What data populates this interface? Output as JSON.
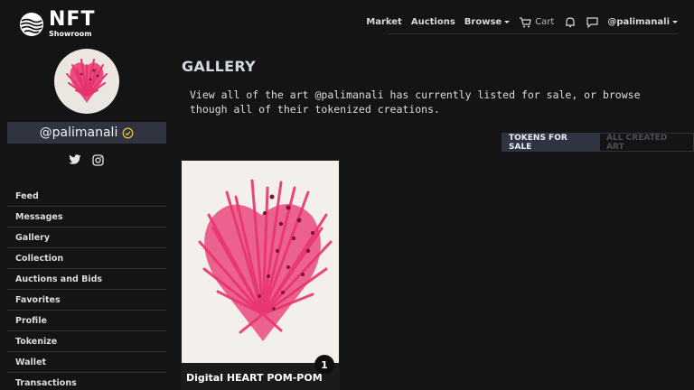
{
  "brand": {
    "name": "NFT",
    "subtitle": "Showroom"
  },
  "nav": {
    "market": "Market",
    "auctions": "Auctions",
    "browse": "Browse",
    "cart": "Cart",
    "user": "@palimanali"
  },
  "profile": {
    "username": "@palimanali",
    "verified": true
  },
  "sidebar": {
    "items": [
      {
        "label": "Feed"
      },
      {
        "label": "Messages"
      },
      {
        "label": "Gallery"
      },
      {
        "label": "Collection"
      },
      {
        "label": "Auctions and Bids"
      },
      {
        "label": "Favorites"
      },
      {
        "label": "Profile"
      },
      {
        "label": "Tokenize"
      },
      {
        "label": "Wallet"
      },
      {
        "label": "Transactions"
      }
    ]
  },
  "main": {
    "title": "GALLERY",
    "intro": "View all of the art @palimanali has currently listed for sale, or browse though all of their tokenized creations.",
    "tabs": [
      {
        "label": "TOKENS FOR SALE",
        "active": true
      },
      {
        "label": "ALL CREATED ART",
        "active": false
      }
    ],
    "cards": [
      {
        "title": "Digital HEART POM-POM",
        "count": "1"
      }
    ]
  },
  "colors": {
    "background": "#141414",
    "panel": "#2f3440",
    "heart_pink": "#e8336f",
    "verified_badge": "#e3c03a"
  },
  "icons": [
    "logo-icon",
    "cart-icon",
    "bell-icon",
    "chat-icon",
    "verified-icon",
    "twitter-icon",
    "instagram-icon"
  ]
}
